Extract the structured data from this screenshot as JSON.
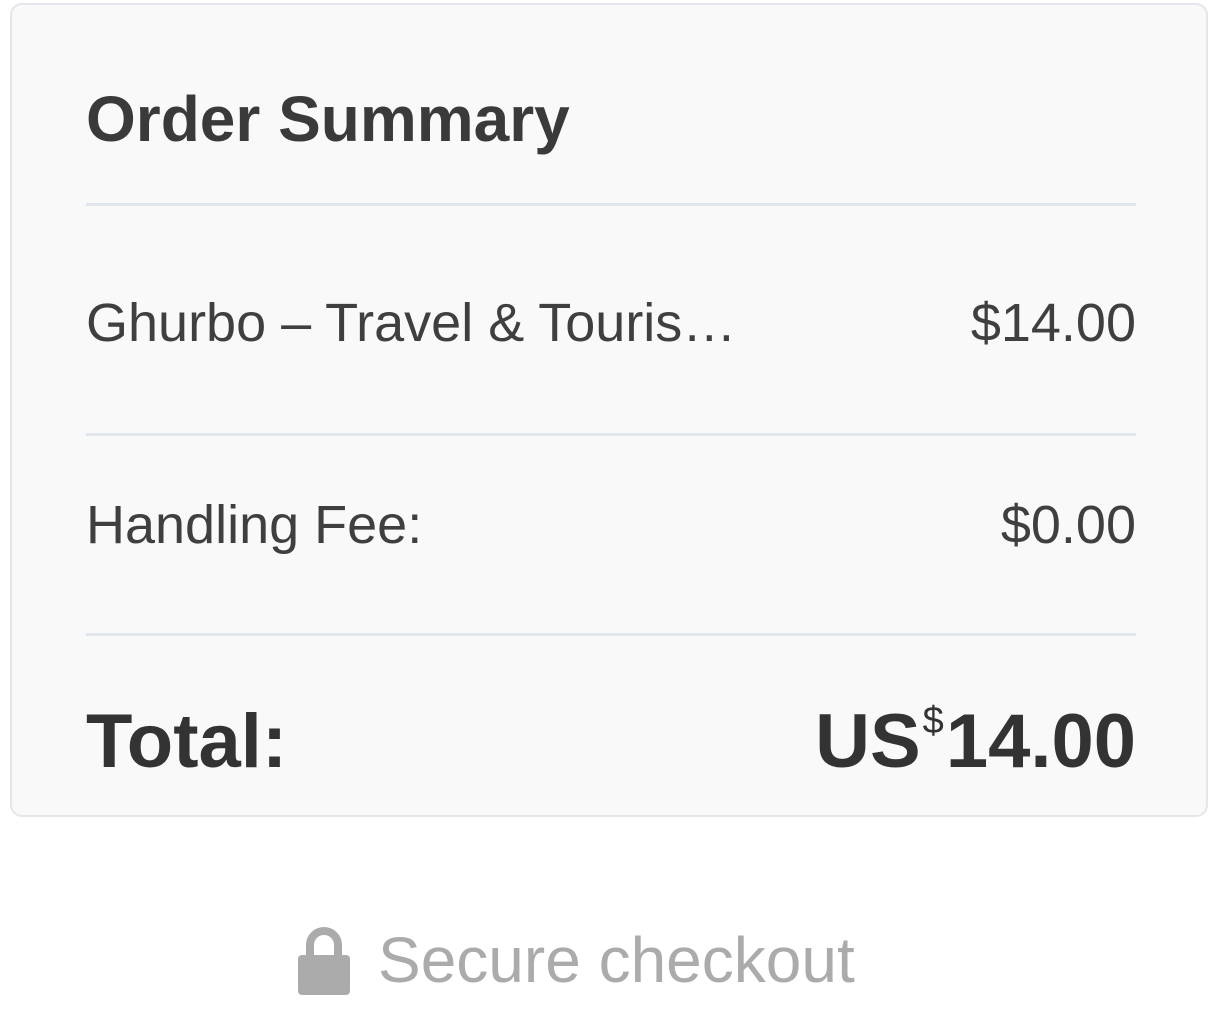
{
  "order_summary": {
    "title": "Order Summary",
    "item": {
      "name": "Ghurbo – Travel & Touris…",
      "price": "$14.00"
    },
    "handling_fee": {
      "label": "Handling Fee:",
      "value": "$0.00"
    },
    "total": {
      "label": "Total:",
      "currency_prefix": "US",
      "currency_symbol": "$",
      "amount": "14.00"
    }
  },
  "secure_checkout": {
    "label": "Secure checkout",
    "icon": "lock-icon"
  },
  "colors": {
    "card_background": "#f9f9f9",
    "card_border": "#e3e6ea",
    "divider": "#e1e6ec",
    "text_primary": "#333333",
    "text_secondary": "#3f3f3f",
    "muted": "#ababab"
  }
}
